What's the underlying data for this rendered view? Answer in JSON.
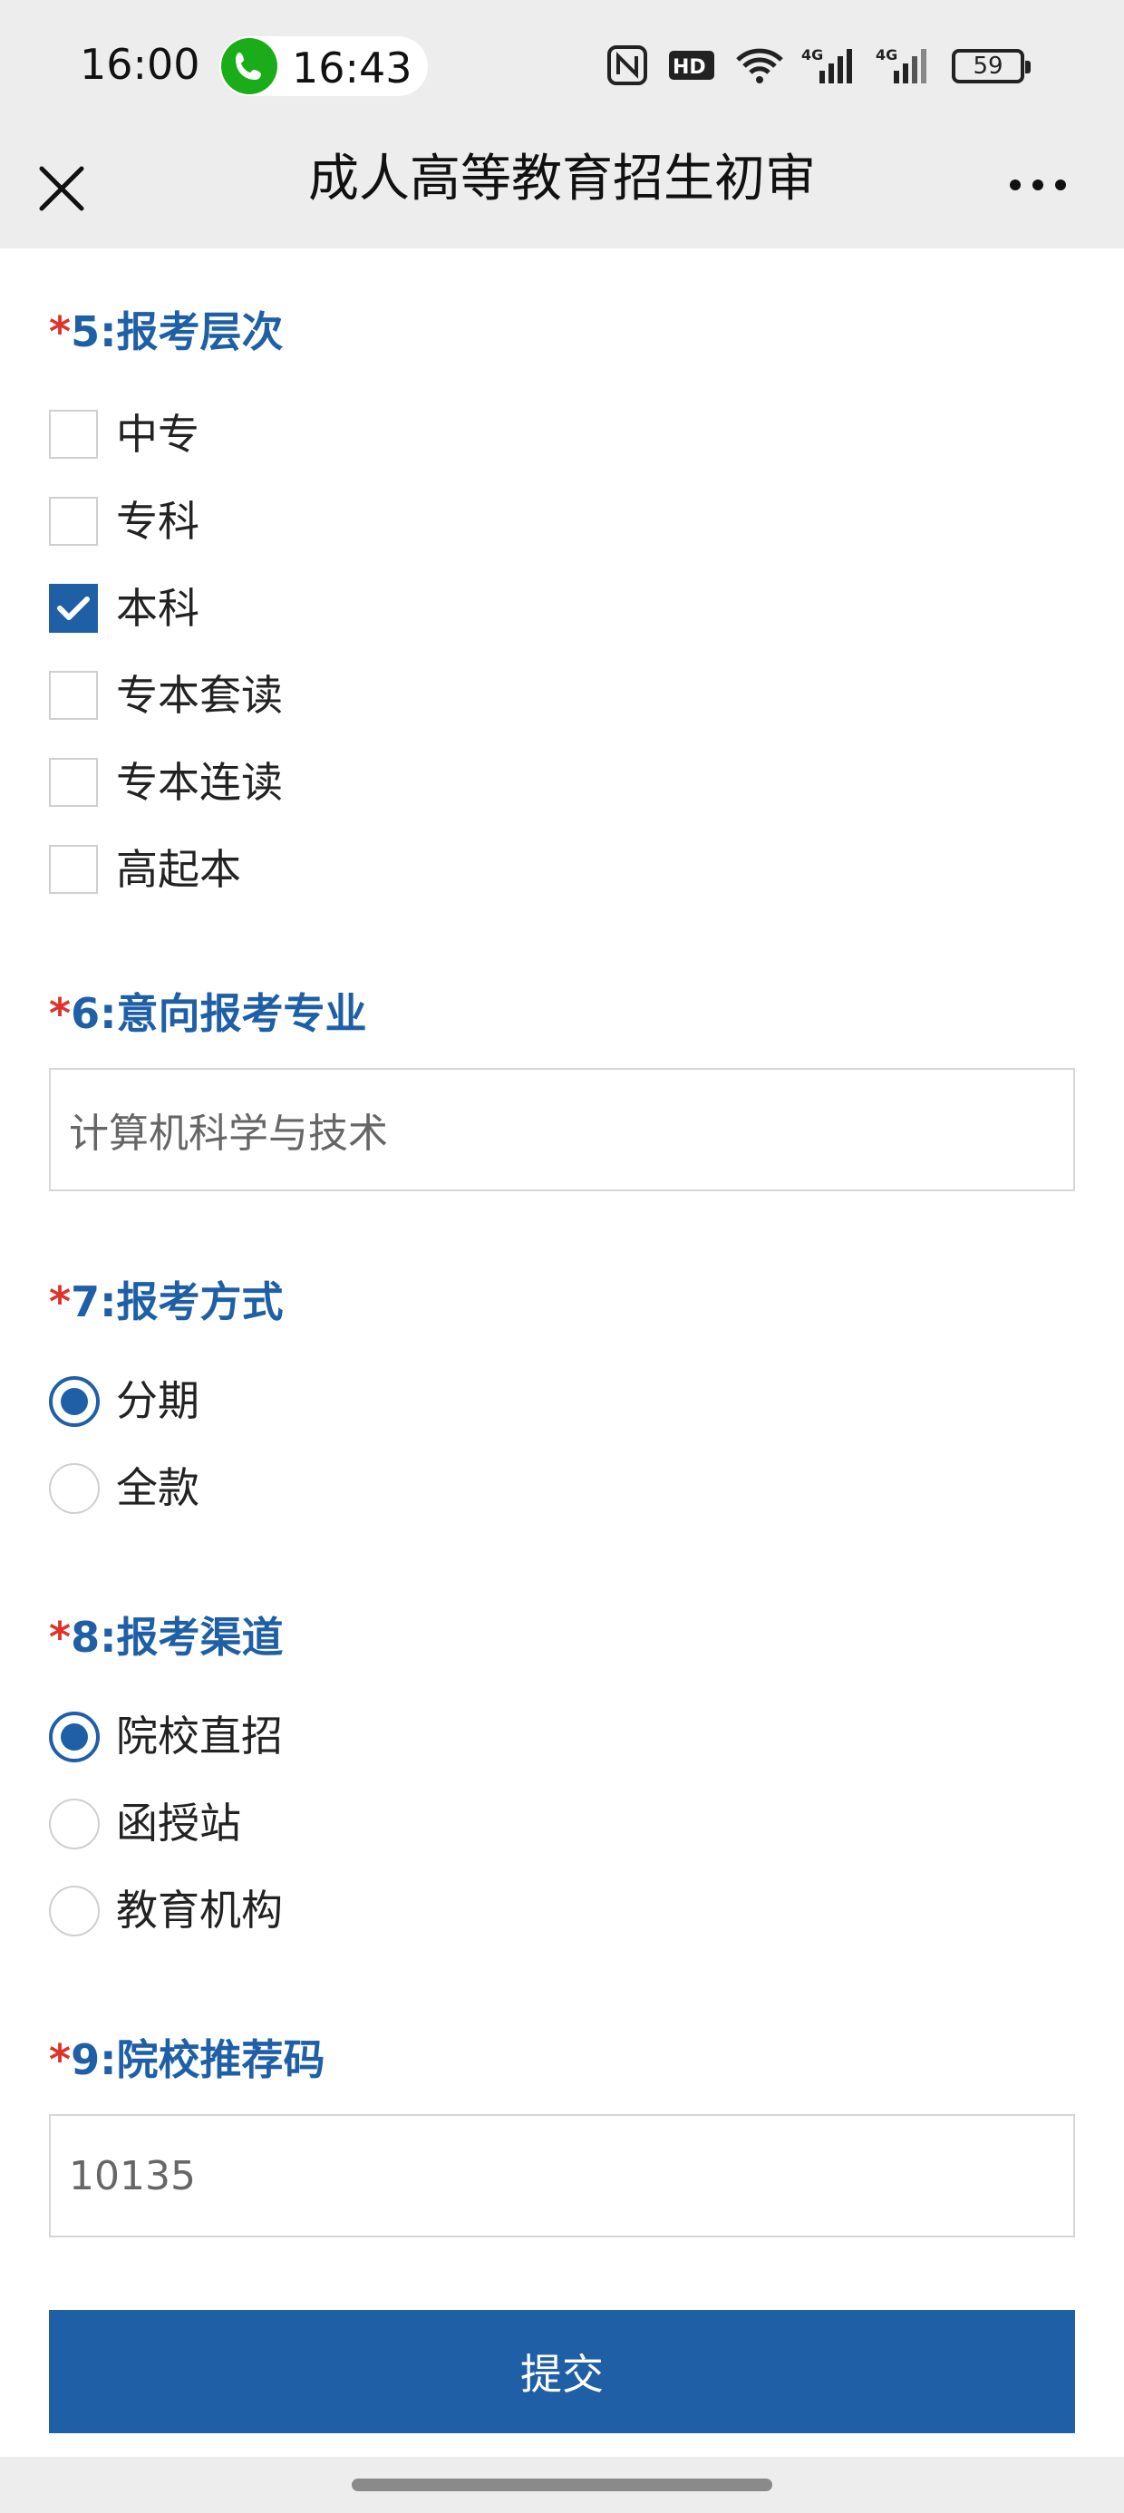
{
  "status_bar": {
    "time": "16:00",
    "call_time": "16:43",
    "battery": "59",
    "icons": [
      "nfc-icon",
      "hd-icon",
      "wifi-icon",
      "signal-4g-icon",
      "signal-4g-icon"
    ]
  },
  "nav": {
    "title": "成人高等教育招生初审",
    "close_icon": "close-icon",
    "more_icon": "more-icon"
  },
  "questions": {
    "q5": {
      "star": "*",
      "title": "5:报考层次",
      "options": [
        {
          "label": "中专",
          "checked": false
        },
        {
          "label": "专科",
          "checked": false
        },
        {
          "label": "本科",
          "checked": true
        },
        {
          "label": "专本套读",
          "checked": false
        },
        {
          "label": "专本连读",
          "checked": false
        },
        {
          "label": "高起本",
          "checked": false
        }
      ]
    },
    "q6": {
      "star": "*",
      "title": "6:意向报考专业",
      "value": "计算机科学与技术"
    },
    "q7": {
      "star": "*",
      "title": "7:报考方式",
      "options": [
        {
          "label": "分期",
          "checked": true
        },
        {
          "label": "全款",
          "checked": false
        }
      ]
    },
    "q8": {
      "star": "*",
      "title": "8:报考渠道",
      "options": [
        {
          "label": "院校直招",
          "checked": true
        },
        {
          "label": "函授站",
          "checked": false
        },
        {
          "label": "教育机构",
          "checked": false
        }
      ]
    },
    "q9": {
      "star": "*",
      "title": "9:院校推荐码",
      "value": "10135"
    }
  },
  "submit_label": "提交",
  "colors": {
    "accent": "#1f5fa6",
    "required_star": "#e0312a",
    "bar_background": "#ededed"
  }
}
